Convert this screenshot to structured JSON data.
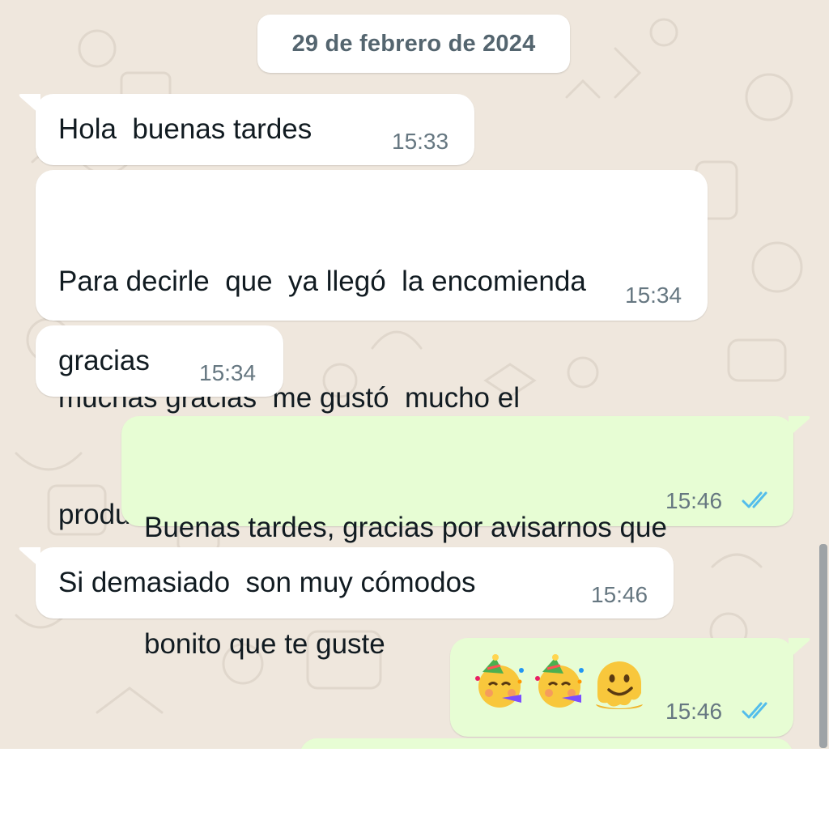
{
  "chat": {
    "date_chip": "29 de febrero de 2024",
    "messages": [
      {
        "direction": "incoming",
        "text": "Hola  buenas tardes",
        "time": "15:33"
      },
      {
        "direction": "incoming",
        "text_lines": [
          "Para decirle  que  ya llegó  la encomienda",
          "muchas gracias  me gustó  mucho el",
          "producto"
        ],
        "time": "15:34"
      },
      {
        "direction": "incoming",
        "text": "gracias",
        "time": "15:34"
      },
      {
        "direction": "outgoing",
        "text_lines": [
          "Buenas tardes, gracias por avisarnos que",
          "bonito que te guste"
        ],
        "time": "15:46",
        "status": "read"
      },
      {
        "direction": "incoming",
        "text": "Si demasiado  son muy cómodos",
        "time": "15:46"
      },
      {
        "direction": "outgoing",
        "emoji": [
          "partying-face-emoji",
          "partying-face-emoji",
          "melting-face-emoji"
        ],
        "time": "15:46",
        "status": "read"
      }
    ]
  },
  "colors": {
    "wallpaper": "#efe7dd",
    "incoming_bubble": "#ffffff",
    "outgoing_bubble": "#e7fdd4",
    "read_ticks": "#53bdeb",
    "timestamp": "#667781"
  }
}
